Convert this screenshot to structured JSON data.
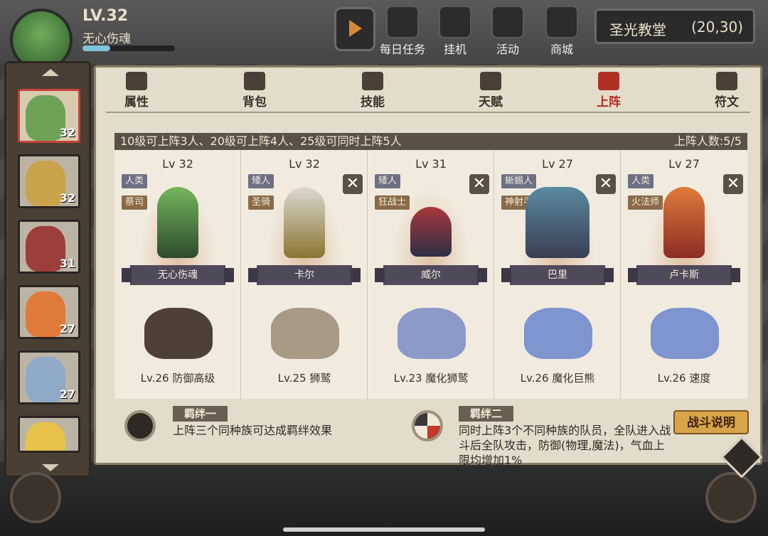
{
  "hud": {
    "level": "LV.32",
    "name": "无心伤魂",
    "exp_fraction": 0.3,
    "buttons": [
      "每日任务",
      "挂机",
      "活动",
      "商城"
    ],
    "location_name": "圣光教堂",
    "location_coords": "(20,30)"
  },
  "roster": {
    "levels": [
      "32",
      "32",
      "31",
      "27",
      "27",
      ""
    ]
  },
  "tabs": [
    "属性",
    "背包",
    "技能",
    "天赋",
    "上阵",
    "符文"
  ],
  "active_tab": "上阵",
  "banner": {
    "rule": "10级可上阵3人、20级可上阵4人、25级可同时上阵5人",
    "count": "上阵人数:5/5"
  },
  "slots": [
    {
      "level": "Lv 32",
      "race": "人类",
      "class": "祭司",
      "name": "无心伤魂",
      "pet": "Lv.26 防御高级",
      "removable": false
    },
    {
      "level": "Lv 32",
      "race": "矮人",
      "class": "圣骑",
      "name": "卡尔",
      "pet": "Lv.25 狮鹫",
      "removable": true
    },
    {
      "level": "Lv 31",
      "race": "矮人",
      "class": "狂战士",
      "name": "威尔",
      "pet": "Lv.23 魔化狮鹫",
      "removable": true
    },
    {
      "level": "Lv 27",
      "race": "蜥蜴人",
      "class": "神射手",
      "name": "巴里",
      "pet": "Lv.26 魔化巨熊",
      "removable": true
    },
    {
      "level": "Lv 27",
      "race": "人类",
      "class": "火法师",
      "name": "卢卡斯",
      "pet": "Lv.26 速度",
      "removable": true
    }
  ],
  "remove_glyph": "✕",
  "bond1": {
    "title": "羁绊一",
    "text": "上阵三个同种族可达成羁绊效果"
  },
  "bond2": {
    "title": "羁绊二",
    "text": "同时上阵3个不同种族的队员，全队进入战斗后全队攻击，防御(物理,魔法)，气血上限均增加1%"
  },
  "help_button": "战斗说明",
  "colors": {
    "active_tab": "#b03026",
    "panel": "#e4dccb",
    "help_button": "#d8a44a"
  }
}
